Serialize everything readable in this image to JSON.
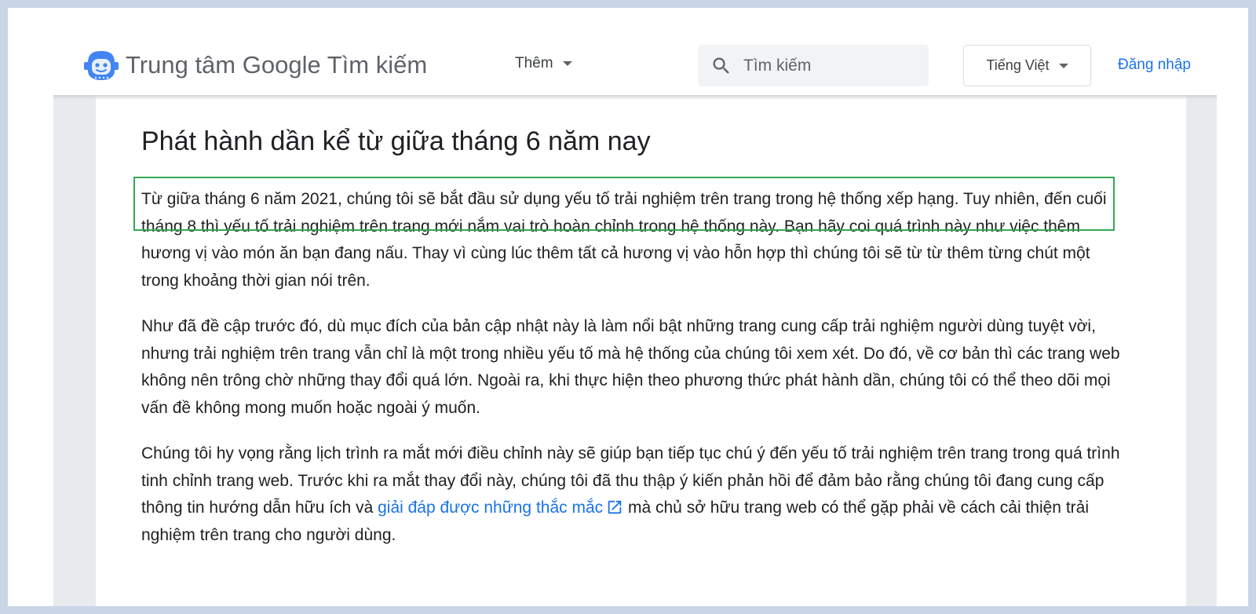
{
  "header": {
    "brand_title": "Trung tâm Google Tìm kiếm",
    "more_label": "Thêm",
    "search_placeholder": "Tìm kiếm",
    "language_label": "Tiếng Việt",
    "login_label": "Đăng nhập"
  },
  "article": {
    "title": "Phát hành dần kể từ giữa tháng 6 năm nay",
    "paragraph1": "Từ giữa tháng 6 năm 2021, chúng tôi sẽ bắt đầu sử dụng yếu tố trải nghiệm trên trang trong hệ thống xếp hạng. Tuy nhiên, đến cuối tháng 8 thì yếu tố trải nghiệm trên trang mới nắm vai trò hoàn chỉnh trong hệ thống này. Bạn hãy coi quá trình này như việc thêm hương vị vào món ăn bạn đang nấu. Thay vì cùng lúc thêm tất cả hương vị vào hỗn hợp thì chúng tôi sẽ từ từ thêm từng chút một trong khoảng thời gian nói trên.",
    "paragraph2": "Như đã đề cập trước đó, dù mục đích của bản cập nhật này là làm nổi bật những trang cung cấp trải nghiệm người dùng tuyệt vời, nhưng trải nghiệm trên trang vẫn chỉ là một trong nhiều yếu tố mà hệ thống của chúng tôi xem xét. Do đó, về cơ bản thì các trang web không nên trông chờ những thay đổi quá lớn. Ngoài ra, khi thực hiện theo phương thức phát hành dần, chúng tôi có thể theo dõi mọi vấn đề không mong muốn hoặc ngoài ý muốn.",
    "paragraph3_before": "Chúng tôi hy vọng rằng lịch trình ra mắt mới điều chỉnh này sẽ giúp bạn tiếp tục chú ý đến yếu tố trải nghiệm trên trang trong quá trình tinh chỉnh trang web. Trước khi ra mắt thay đổi này, chúng tôi đã thu thập ý kiến phản hồi để đảm bảo rằng chúng tôi đang cung cấp thông tin hướng dẫn hữu ích và ",
    "paragraph3_link": "giải đáp được những thắc mắc",
    "paragraph3_after": " mà chủ sở hữu trang web có thể gặp phải về cách cải thiện trải nghiệm trên trang cho người dùng."
  },
  "icons": {
    "logo": "google-search-central-mascot-icon",
    "search": "search-icon",
    "more_caret": "caret-down-icon",
    "lang_caret": "caret-down-icon",
    "external": "external-link-icon"
  },
  "colors": {
    "link": "#1a73e8",
    "highlight_border": "#34a853",
    "background_outer": "#c9d6e6",
    "content_gutter": "#e8eaed"
  }
}
